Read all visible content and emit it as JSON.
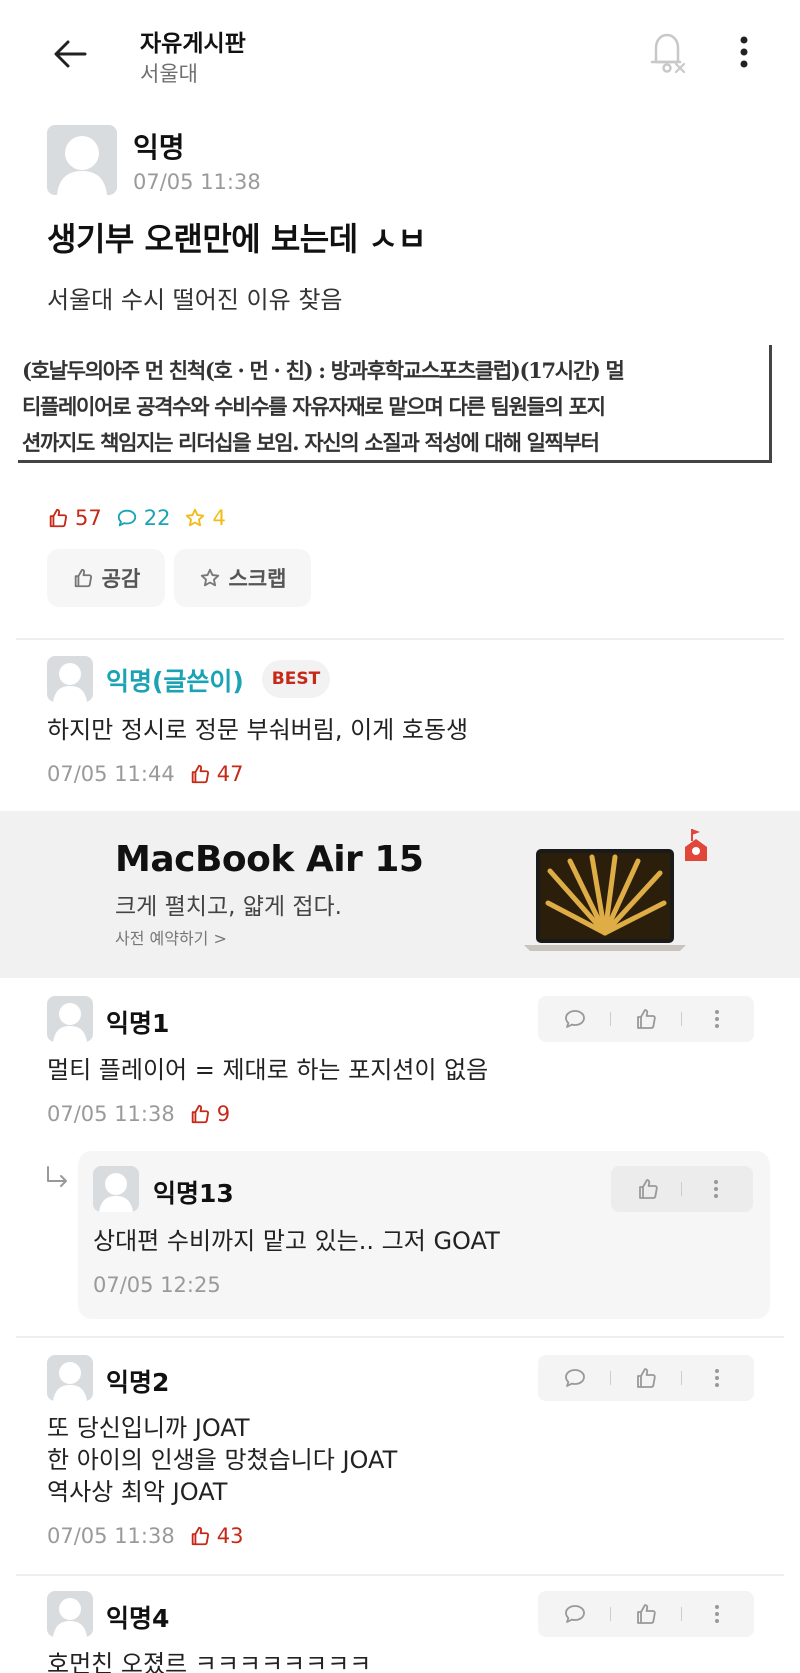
{
  "header": {
    "board_title": "자유게시판",
    "board_sub": "서울대",
    "icons": [
      "back-arrow-icon",
      "notification-off-icon",
      "more-vertical-icon"
    ]
  },
  "post": {
    "author": "익명",
    "time": "07/05 11:38",
    "title": "생기부 오랜만에 보는데 ㅅㅂ",
    "body": "서울대 수시 떨어진 이유 찾음",
    "scan_lines": [
      "(호날두의아주 먼 친척(호 · 먼 · 친) : 방과후학교스포츠클럽)(17시간) 멀",
      "티플레이어로 공격수와 수비수를 자유자재로 맡으며 다른 팀원들의 포지",
      "션까지도 책임지는 리더십을 보임. 자신의 소질과 적성에 대해 일찍부터"
    ],
    "stats": {
      "likes": "57",
      "comments": "22",
      "scraps": "4"
    },
    "like_button": "공감",
    "scrap_button": "스크랩"
  },
  "best_comment": {
    "author": "익명(글쓴이)",
    "badge": "BEST",
    "text": "하지만 정시로 정문 부숴버림, 이게 호동생",
    "time": "07/05 11:44",
    "likes": "47"
  },
  "ad": {
    "title": "MacBook Air 15",
    "subtitle": "크게 펼치고, 얇게 접다.",
    "cta": "사전 예약하기 >"
  },
  "comments": [
    {
      "author": "익명1",
      "text": "멀티 플레이어 = 제대로 하는 포지션이 없음",
      "time": "07/05 11:38",
      "likes": "9",
      "reply": {
        "author": "익명13",
        "text": "상대편 수비까지 맡고 있는.. 그저 GOAT",
        "time": "07/05 12:25"
      }
    },
    {
      "author": "익명2",
      "lines": [
        "또 당신입니까 JOAT",
        "한 아이의 인생을 망쳤습니다 JOAT",
        "역사상 최악 JOAT"
      ],
      "time": "07/05 11:38",
      "likes": "43"
    },
    {
      "author": "익명4",
      "text": "호먼친 오졌르 ㅋㅋㅋㅋㅋㅋㅋㅋ"
    }
  ],
  "colors": {
    "like_red": "#c62917",
    "teal": "#1aa3b5",
    "gold": "#f2bc14",
    "muted_gray": "#9a9a9a"
  }
}
